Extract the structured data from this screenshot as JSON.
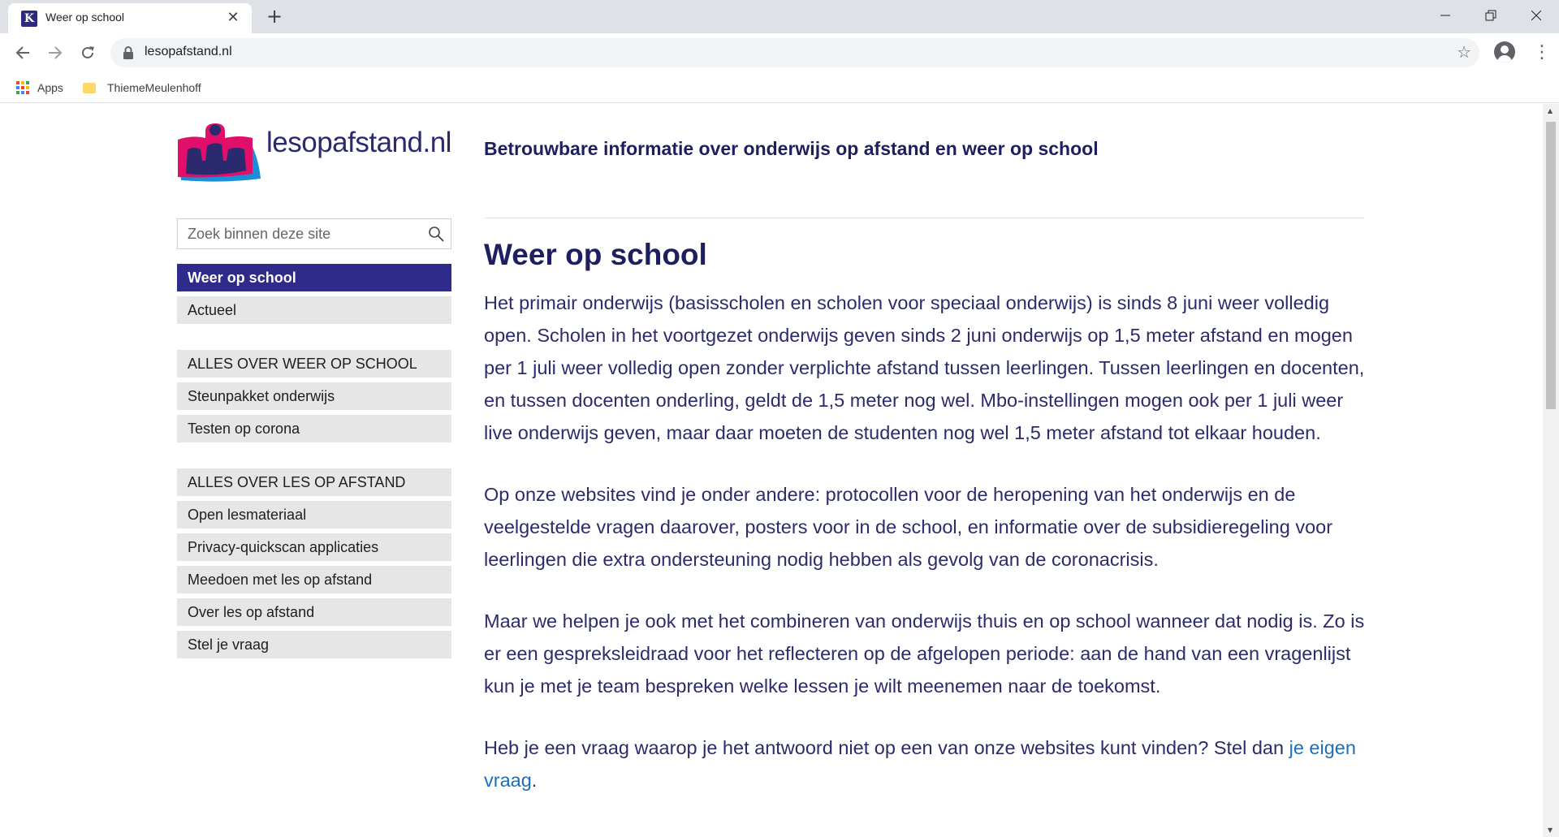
{
  "browser": {
    "tab_title": "Weer op school",
    "favicon_letter": "K",
    "url": "lesopafstand.nl",
    "bookmarks": [
      {
        "label": "Apps"
      },
      {
        "label": "ThiemeMeulenhoff"
      }
    ]
  },
  "site": {
    "logo_text": "lesopafstand.nl",
    "tagline": "Betrouwbare informatie over onderwijs op afstand en weer op school",
    "search_placeholder": "Zoek binnen deze site",
    "colors": {
      "brand": "#2f2b8a",
      "logo_pink": "#e0106a",
      "logo_blue": "#1a8fd8",
      "link": "#1f6fb8"
    }
  },
  "nav": {
    "top": [
      {
        "label": "Weer op school",
        "active": true
      },
      {
        "label": "Actueel"
      }
    ],
    "group1": {
      "heading": "ALLES OVER WEER OP SCHOOL",
      "items": [
        "Steunpakket onderwijs",
        "Testen op corona"
      ]
    },
    "group2": {
      "heading": "ALLES OVER LES OP AFSTAND",
      "items": [
        "Open lesmateriaal",
        "Privacy-quickscan applicaties",
        "Meedoen met les op afstand",
        "Over les op afstand",
        "Stel je vraag"
      ]
    }
  },
  "content": {
    "title": "Weer op school",
    "p1": "Het primair onderwijs (basisscholen en scholen voor speciaal onderwijs) is sinds 8 juni weer volledig open. Scholen in het voortgezet onderwijs geven sinds 2 juni onderwijs op 1,5 meter afstand en mogen per 1 juli weer volledig open zonder verplichte afstand tussen leerlingen. Tussen leerlingen en docenten, en tussen docenten onderling, geldt de 1,5 meter nog wel. Mbo-instellingen mogen ook per 1 juli weer live onderwijs geven, maar daar moeten de studenten nog wel 1,5 meter afstand tot elkaar houden.",
    "p2": "Op onze websites vind je onder andere: protocollen voor de heropening van het onderwijs en de veelgestelde vragen daarover, posters voor in de school, en informatie over de subsidieregeling voor leerlingen die extra ondersteuning nodig hebben als gevolg van de coronacrisis.",
    "p3": "Maar we helpen je ook met het combineren van onderwijs thuis en op school wanneer dat nodig is. Zo is er een gespreksleidraad voor het reflecteren op de afgelopen periode: aan de hand van een vragenlijst kun je met je team bespreken welke lessen je wilt meenemen naar de toekomst.",
    "p4_before": "Heb je een vraag waarop je het antwoord niet op een van onze websites kunt vinden? Stel dan ",
    "p4_link": "je eigen vraag",
    "p4_after": "."
  }
}
